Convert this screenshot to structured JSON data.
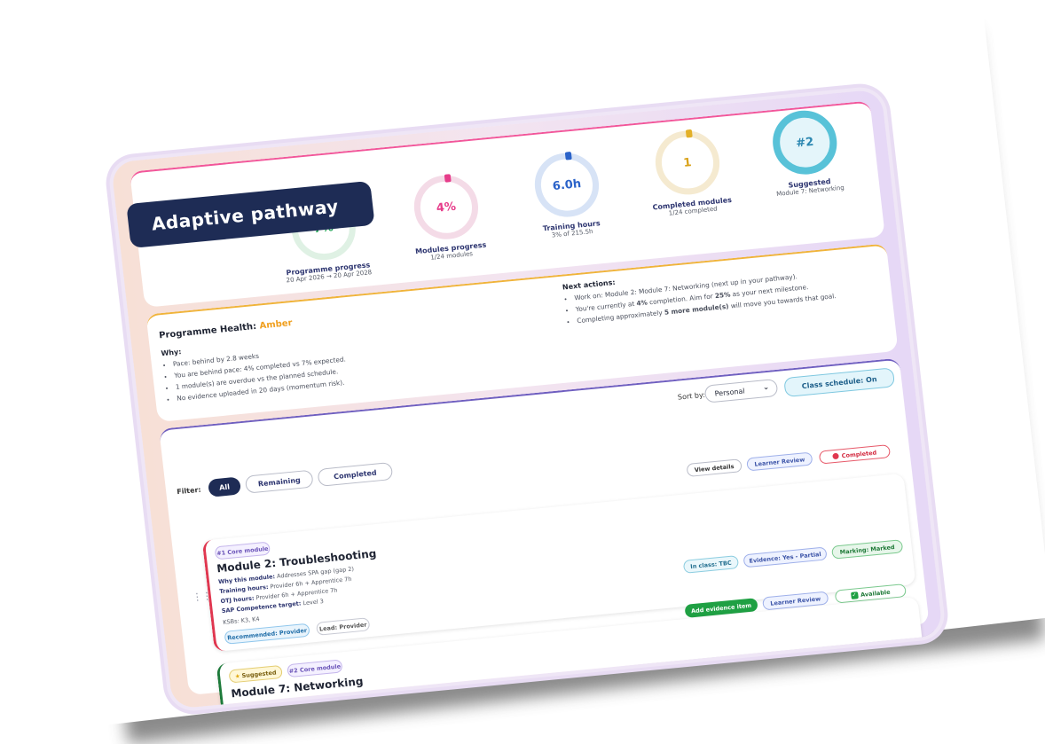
{
  "badge": {
    "title": "Adaptive pathway"
  },
  "stats": {
    "programme": {
      "value": "7%",
      "label": "Programme progress",
      "sub": "20 Apr 2026 → 20 Apr 2028"
    },
    "modules": {
      "value": "4%",
      "label": "Modules progress",
      "sub": "1/24 modules"
    },
    "hours": {
      "value": "6.0h",
      "label": "Training hours",
      "sub": "3% of 215.5h"
    },
    "completed": {
      "value": "1",
      "label": "Completed modules",
      "sub": "1/24 completed"
    },
    "suggested": {
      "value": "#2",
      "label": "Suggested",
      "sub": "Module 7: Networking"
    }
  },
  "health": {
    "title_prefix": "Programme Health:",
    "status": "Amber",
    "why_label": "Why:",
    "why": [
      "Pace: behind by 2.8 weeks",
      "You are behind pace: 4% completed vs 7% expected.",
      "1 module(s) are overdue vs the planned schedule.",
      "No evidence uploaded in 20 days (momentum risk)."
    ],
    "next_label": "Next actions:",
    "next": [
      {
        "pre": "Work on: Module 2: Module 7: Networking (next up in your pathway).",
        "b": "",
        "post": "",
        "b2": "",
        "post2": ""
      },
      {
        "pre": "You're currently at ",
        "b": "4%",
        "post": " completion. Aim for ",
        "b2": "25%",
        "post2": " as your next milestone."
      },
      {
        "pre": "Completing approximately ",
        "b": "5 more module(s)",
        "post": " will move you towards that goal.",
        "b2": "",
        "post2": ""
      }
    ]
  },
  "toolbar": {
    "sort_label": "Sort by:",
    "sort_value": "Personal",
    "class_schedule": "Class schedule: On",
    "filter_label": "Filter:",
    "filters": [
      "All",
      "Remaining",
      "Completed"
    ]
  },
  "modules": [
    {
      "actions": [
        "View details",
        "Learner Review",
        "Completed"
      ],
      "tag": "#1 Core module",
      "title": "Module 2: Troubleshooting",
      "why_label": "Why this module:",
      "why": "Addresses SPA gap (gap 2)",
      "hours_label": "Training hours:",
      "hours": "Provider 6h + Apprentice 7h",
      "otj_label": "OTJ hours:",
      "otj": "Provider 6h + Apprentice 7h",
      "sap_label": "SAP Competence target:",
      "sap": "Level 3",
      "ksbs": "KSBs: K3, K4",
      "recommended": "Recommended: Provider",
      "lead": "Lead: Provider",
      "in_class": "In class: TBC",
      "evidence": "Evidence: Yes - Partial",
      "marking": "Marking: Marked"
    },
    {
      "actions": [
        "Add evidence item",
        "Learner Review",
        "Available"
      ],
      "suggested": "Suggested",
      "tag": "#2 Core module",
      "title": "Module 7: Networking"
    }
  ]
}
